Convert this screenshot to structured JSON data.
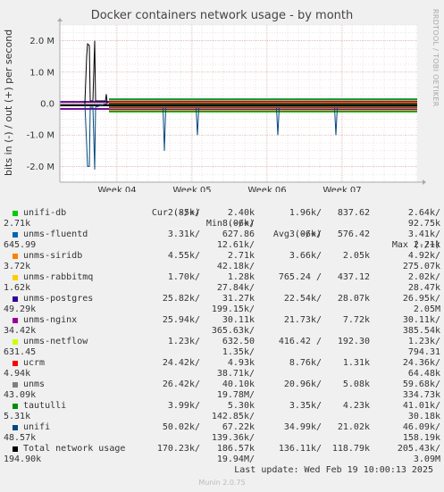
{
  "chart_data": {
    "type": "line",
    "title": "Docker containers network usage - by month",
    "ylabel": "bits in (-) / out (+) per second",
    "watermark": "RRDTOOL / TOBI OETIKER",
    "y_ticks": [
      "2.0 M",
      "1.0 M",
      "0.0",
      "-1.0 M",
      "-2.0 M"
    ],
    "ylim": [
      -2500000,
      2500000
    ],
    "x_ticks": [
      "Week 04",
      "Week 05",
      "Week 06",
      "Week 07"
    ],
    "grid": true,
    "legend_header": {
      "cur": "Cur (-/+)",
      "min": "Min (-/+)",
      "avg": "Avg (-/+)",
      "max": "Max (-/+)"
    },
    "series": [
      {
        "name": "unifi-db",
        "color": "#00cc00",
        "cur_out": "2.85k/",
        "min_out": "2.40k",
        "avg_out": "1.96k/",
        "avg_in": "837.62",
        "max_out": "2.64k/",
        "cur_in": "2.71k",
        "min_in": "8.06k/",
        "max_in": "92.75k"
      },
      {
        "name": "unms-fluentd",
        "color": "#0066b3",
        "cur_out": "3.31k/",
        "min_out": "627.86",
        "avg_out": "3.06k/",
        "avg_in": "576.42",
        "max_out": "3.41k/",
        "cur_in": "645.99",
        "min_in": "12.61k/",
        "max_in": "2.21k"
      },
      {
        "name": "unms-siridb",
        "color": "#ff8000",
        "cur_out": "4.55k/",
        "min_out": "2.71k",
        "avg_out": "3.66k/",
        "avg_in": "2.05k",
        "max_out": "4.92k/",
        "cur_in": "3.72k",
        "min_in": "42.18k/",
        "max_in": "275.07k"
      },
      {
        "name": "unms-rabbitmq",
        "color": "#ffcc00",
        "cur_out": "1.70k/",
        "min_out": "1.28k",
        "avg_out": "765.24 /",
        "avg_in": "437.12",
        "max_out": "2.02k/",
        "cur_in": "1.62k",
        "min_in": "27.84k/",
        "max_in": "28.47k"
      },
      {
        "name": "unms-postgres",
        "color": "#330099",
        "cur_out": "25.82k/",
        "min_out": "31.27k",
        "avg_out": "22.54k/",
        "avg_in": "28.07k",
        "max_out": "26.95k/",
        "cur_in": "49.29k",
        "min_in": "199.15k/",
        "max_in": "2.05M"
      },
      {
        "name": "unms-nginx",
        "color": "#990099",
        "cur_out": "25.94k/",
        "min_out": "30.11k",
        "avg_out": "21.73k/",
        "avg_in": "7.72k",
        "max_out": "30.11k/",
        "cur_in": "34.42k",
        "min_in": "365.63k/",
        "max_in": "385.54k"
      },
      {
        "name": "unms-netflow",
        "color": "#ccff00",
        "cur_out": "1.23k/",
        "min_out": "632.50",
        "avg_out": "416.42 /",
        "avg_in": "192.30",
        "max_out": "1.23k/",
        "cur_in": "631.45",
        "min_in": "1.35k/",
        "max_in": "794.31"
      },
      {
        "name": "ucrm",
        "color": "#ff0000",
        "cur_out": "24.42k/",
        "min_out": "4.93k",
        "avg_out": "8.76k/",
        "avg_in": "1.31k",
        "max_out": "24.36k/",
        "cur_in": "4.94k",
        "min_in": "38.71k/",
        "max_in": "64.48k"
      },
      {
        "name": "unms",
        "color": "#808080",
        "cur_out": "26.42k/",
        "min_out": "40.10k",
        "avg_out": "20.96k/",
        "avg_in": "5.08k",
        "max_out": "59.68k/",
        "cur_in": "43.09k",
        "min_in": "19.78M/",
        "max_in": "334.73k"
      },
      {
        "name": "tautulli",
        "color": "#008f00",
        "cur_out": "3.99k/",
        "min_out": "5.30k",
        "avg_out": "3.35k/",
        "avg_in": "4.23k",
        "max_out": "41.01k/",
        "cur_in": "5.31k",
        "min_in": "142.85k/",
        "max_in": "30.18k"
      },
      {
        "name": "unifi",
        "color": "#00487d",
        "cur_out": "50.02k/",
        "min_out": "67.22k",
        "avg_out": "34.99k/",
        "avg_in": "21.02k",
        "max_out": "46.09k/",
        "cur_in": "48.57k",
        "min_in": "139.36k/",
        "max_in": "158.19k"
      },
      {
        "name": "Total network usage",
        "color": "#000000",
        "cur_out": "170.23k/",
        "min_out": "186.57k",
        "avg_out": "136.11k/",
        "avg_in": "118.79k",
        "max_out": "205.43k/",
        "cur_in": "194.90k",
        "min_in": "19.94M/",
        "max_in": "3.09M"
      }
    ]
  },
  "footer": {
    "last_update": "Last update: Wed Feb 19 10:00:13 2025",
    "munin": "Munin 2.0.75"
  }
}
